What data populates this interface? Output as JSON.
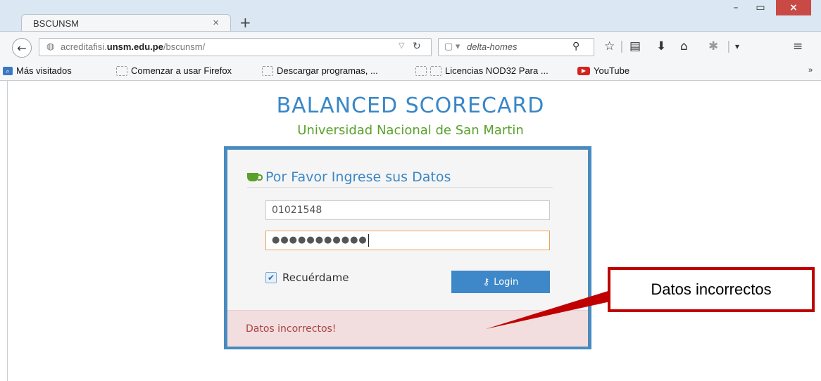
{
  "browser": {
    "tab_title": "BSCUNSM",
    "tab_close": "×",
    "new_tab": "+",
    "window_controls": {
      "minimize": "–",
      "maximize": "▭",
      "close": "×"
    },
    "url": {
      "prefix": "acreditafisi.",
      "domain": "unsm.edu.pe",
      "path": "/bscunsm/"
    },
    "search_placeholder": "delta-homes",
    "bookmarks": [
      "Más visitados",
      "Comenzar a usar Firefox",
      "Descargar programas, ...",
      "Licencias NOD32 Para ...",
      "YouTube"
    ],
    "bookmarks_more": "»"
  },
  "page": {
    "heading": "BALANCED SCORECARD",
    "subheading": "Universidad Nacional de San Martin",
    "login": {
      "panel_title": "Por Favor Ingrese sus Datos",
      "username_value": "01021548",
      "password_value": "●●●●●●●●●●●",
      "remember_label": "Recuérdame",
      "remember_checked": true,
      "login_button": "Login",
      "error_message": "Datos incorrectos!"
    },
    "callout_text": "Datos incorrectos"
  },
  "colors": {
    "accent": "#3a87c7",
    "success_green": "#5aa12c",
    "alert_bg": "#f2dede",
    "alert_text": "#a94442",
    "callout_red": "#c00000"
  }
}
